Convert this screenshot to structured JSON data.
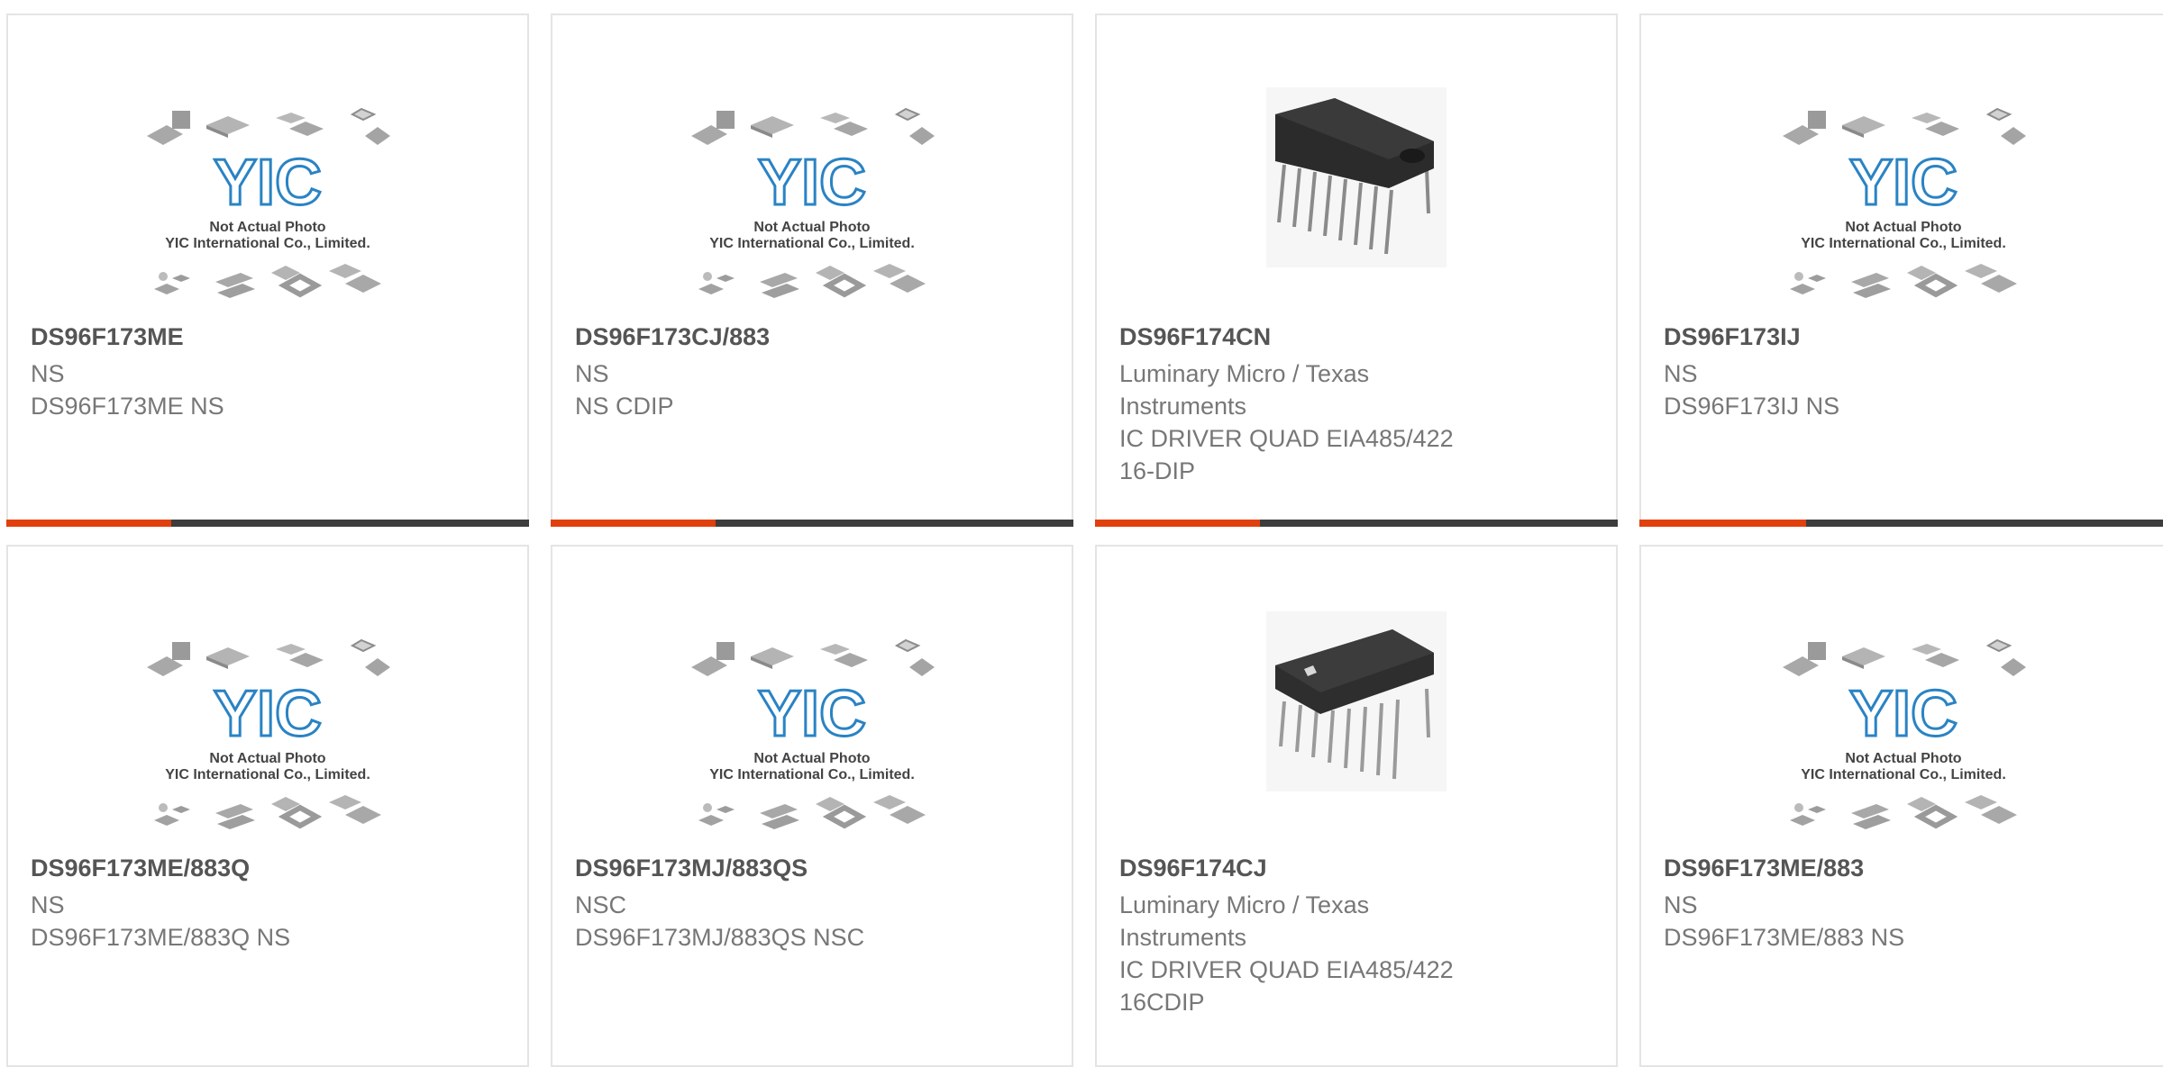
{
  "accent_color": "#e0400e",
  "placeholder": {
    "logo_text": "YIC",
    "caption_line1": "Not Actual Photo",
    "caption_line2": "YIC International Co., Limited."
  },
  "products": [
    {
      "part": "DS96F173ME",
      "manufacturer": "NS",
      "description": "DS96F173ME NS",
      "image": "placeholder",
      "progress": 0.315
    },
    {
      "part": "DS96F173CJ/883",
      "manufacturer": "NS",
      "description": "NS CDIP",
      "image": "placeholder",
      "progress": 0.315
    },
    {
      "part": "DS96F174CN",
      "manufacturer": "Luminary Micro / Texas Instruments",
      "description": "IC DRIVER QUAD EIA485/422 16-DIP",
      "image": "dip-chip",
      "progress": 0.315
    },
    {
      "part": "DS96F173IJ",
      "manufacturer": "NS",
      "description": "DS96F173IJ NS",
      "image": "placeholder",
      "progress": 0.315
    },
    {
      "part": "DS96F173ME/883Q",
      "manufacturer": "NS",
      "description": "DS96F173ME/883Q NS",
      "image": "placeholder"
    },
    {
      "part": "DS96F173MJ/883QS",
      "manufacturer": "NSC",
      "description": "DS96F173MJ/883QS NSC",
      "image": "placeholder"
    },
    {
      "part": "DS96F174CJ",
      "manufacturer": "Luminary Micro / Texas Instruments",
      "description": "IC DRIVER QUAD EIA485/422 16CDIP",
      "image": "cdip-chip"
    },
    {
      "part": "DS96F173ME/883",
      "manufacturer": "NS",
      "description": "DS96F173ME/883 NS",
      "image": "placeholder"
    }
  ]
}
